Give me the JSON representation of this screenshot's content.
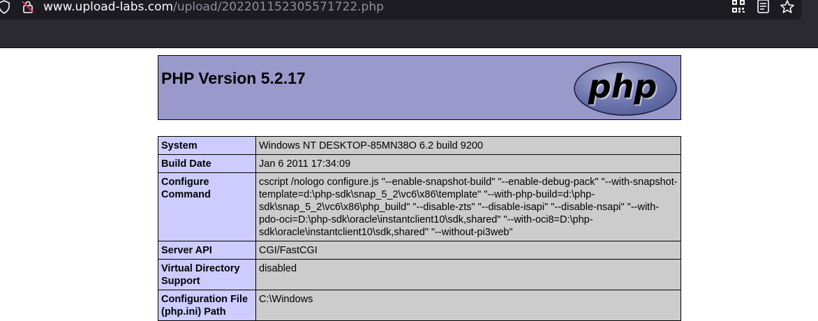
{
  "browser": {
    "url_domain": "www.upload-labs.com",
    "url_path": "/upload/202201152305571722.php",
    "icons": [
      "shield-icon",
      "insecure-lock-icon",
      "qr-code-icon",
      "reader-view-icon",
      "bookmark-star-icon"
    ]
  },
  "page": {
    "title": "PHP Version 5.2.17",
    "logo_text": "php",
    "colors": {
      "header_bg": "#9999cc",
      "label_bg": "#ccccff",
      "value_bg": "#cccccc"
    },
    "rows": [
      {
        "label": "System",
        "value": "Windows NT DESKTOP-85MN38O 6.2 build 9200"
      },
      {
        "label": "Build Date",
        "value": "Jan 6 2011 17:34:09"
      },
      {
        "label": "Configure Command",
        "value": "cscript /nologo configure.js \"--enable-snapshot-build\" \"--enable-debug-pack\" \"--with-snapshot-template=d:\\php-sdk\\snap_5_2\\vc6\\x86\\template\" \"--with-php-build=d:\\php-sdk\\snap_5_2\\vc6\\x86\\php_build\" \"--disable-zts\" \"--disable-isapi\" \"--disable-nsapi\" \"--with-pdo-oci=D:\\php-sdk\\oracle\\instantclient10\\sdk,shared\" \"--with-oci8=D:\\php-sdk\\oracle\\instantclient10\\sdk,shared\" \"--without-pi3web\""
      },
      {
        "label": "Server API",
        "value": "CGI/FastCGI"
      },
      {
        "label": "Virtual Directory Support",
        "value": "disabled"
      },
      {
        "label": "Configuration File (php.ini) Path",
        "value": "C:\\Windows"
      }
    ]
  }
}
